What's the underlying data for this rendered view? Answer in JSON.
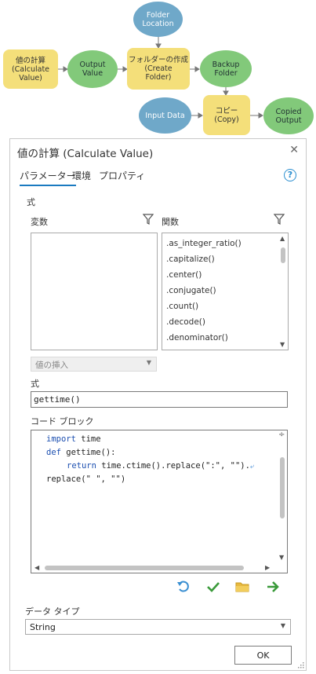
{
  "diagram": {
    "nodes": {
      "folder_location": "Folder\nLocation",
      "calculate_value": "値の計算\n(Calculate\nValue)",
      "output_value": "Output\nValue",
      "create_folder": "フォルダーの作成\n(Create\nFolder)",
      "backup_folder": "Backup\nFolder",
      "input_data": "Input Data",
      "copy": "コピー\n(Copy)",
      "copied_output": "Copied\nOutput"
    }
  },
  "dialog": {
    "title": "値の計算 (Calculate Value)",
    "close_glyph": "✕",
    "tabs": [
      "パラメーター",
      "環境",
      "プロパティ"
    ],
    "help_glyph": "?",
    "expression_section_label": "式",
    "variables_label": "変数",
    "functions_label": "関数",
    "functions": [
      ".as_integer_ratio()",
      ".capitalize()",
      ".center()",
      ".conjugate()",
      ".count()",
      ".decode()",
      ".denominator()"
    ],
    "insert_value_label": "値の挿入",
    "expression_label": "式",
    "expression_value": "gettime()",
    "code_block_label": "コード ブロック",
    "code_lines": {
      "l1_kw": "import",
      "l1_rest": " time",
      "l2_kw": "def",
      "l2_rest": " gettime():",
      "l3_kw": "return",
      "l3_rest": " time.ctime().replace(\":\", \"\").",
      "l4": "replace(\" \", \"\")"
    },
    "data_type_label": "データ タイプ",
    "data_type_value": "String",
    "ok_label": "OK"
  },
  "colors": {
    "accent": "#1a7ac0",
    "node_blue": "#6fa8c9",
    "node_green": "#82c97a",
    "node_yellow": "#f4df7a"
  },
  "icons": [
    "close-icon",
    "help-icon",
    "filter-icon",
    "chevron-down-icon",
    "undo-icon",
    "check-icon",
    "folder-icon",
    "arrow-right-icon",
    "wrap-icon",
    "resize-grip-icon"
  ]
}
